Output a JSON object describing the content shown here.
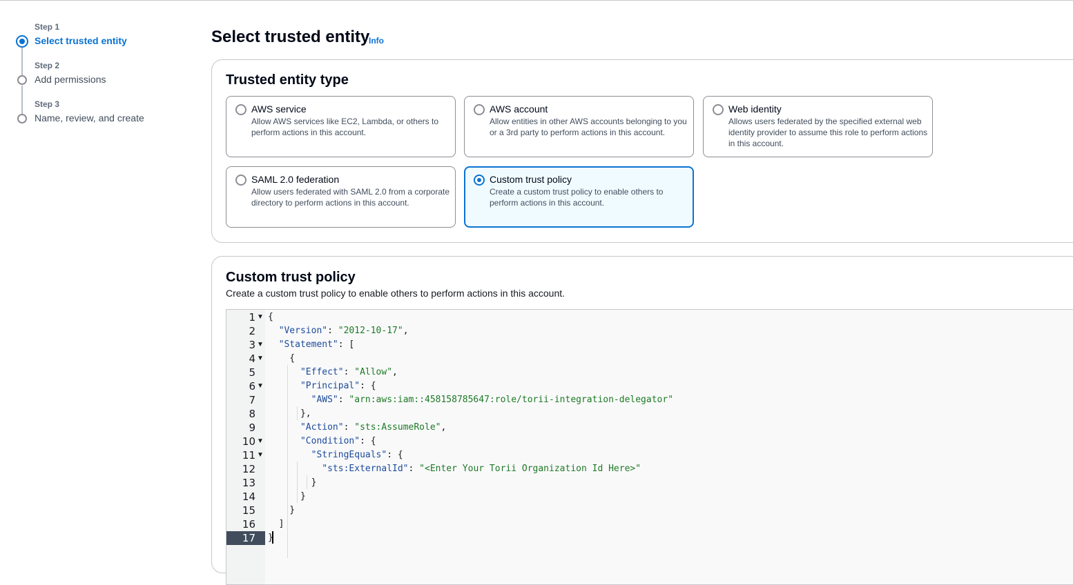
{
  "steps": [
    {
      "number": "Step 1",
      "title": "Select trusted entity",
      "active": true
    },
    {
      "number": "Step 2",
      "title": "Add permissions",
      "active": false
    },
    {
      "number": "Step 3",
      "title": "Name, review, and create",
      "active": false
    }
  ],
  "header": {
    "title": "Select trusted entity",
    "info_label": "Info"
  },
  "entity_type": {
    "title": "Trusted entity type",
    "options": [
      {
        "label": "AWS service",
        "description": "Allow AWS services like EC2, Lambda, or others to perform actions in this account.",
        "selected": false
      },
      {
        "label": "AWS account",
        "description": "Allow entities in other AWS accounts belonging to you or a 3rd party to perform actions in this account.",
        "selected": false
      },
      {
        "label": "Web identity",
        "description": "Allows users federated by the specified external web identity provider to assume this role to perform actions in this account.",
        "selected": false
      },
      {
        "label": "SAML 2.0 federation",
        "description": "Allow users federated with SAML 2.0 from a corporate directory to perform actions in this account.",
        "selected": false
      },
      {
        "label": "Custom trust policy",
        "description": "Create a custom trust policy to enable others to perform actions in this account.",
        "selected": true
      }
    ]
  },
  "policy": {
    "title": "Custom trust policy",
    "description": "Create a custom trust policy to enable others to perform actions in this account.",
    "active_line": 17,
    "lines": [
      {
        "n": "1",
        "fold": true,
        "text": "{"
      },
      {
        "n": "2",
        "fold": false,
        "text": "  \"Version\": \"2012-10-17\","
      },
      {
        "n": "3",
        "fold": true,
        "text": "  \"Statement\": ["
      },
      {
        "n": "4",
        "fold": true,
        "text": "    {"
      },
      {
        "n": "5",
        "fold": false,
        "text": "      \"Effect\": \"Allow\","
      },
      {
        "n": "6",
        "fold": true,
        "text": "      \"Principal\": {"
      },
      {
        "n": "7",
        "fold": false,
        "text": "        \"AWS\": \"arn:aws:iam::458158785647:role/torii-integration-delegator\""
      },
      {
        "n": "8",
        "fold": false,
        "text": "      },"
      },
      {
        "n": "9",
        "fold": false,
        "text": "      \"Action\": \"sts:AssumeRole\","
      },
      {
        "n": "10",
        "fold": true,
        "text": "      \"Condition\": {"
      },
      {
        "n": "11",
        "fold": true,
        "text": "        \"StringEquals\": {"
      },
      {
        "n": "12",
        "fold": false,
        "text": "          \"sts:ExternalId\": \"<Enter Your Torii Organization Id Here>\""
      },
      {
        "n": "13",
        "fold": false,
        "text": "        }"
      },
      {
        "n": "14",
        "fold": false,
        "text": "      }"
      },
      {
        "n": "15",
        "fold": false,
        "text": "    }"
      },
      {
        "n": "16",
        "fold": false,
        "text": "  ]"
      },
      {
        "n": "17",
        "fold": false,
        "text": "}"
      }
    ]
  },
  "colors": {
    "accent": "#0972d3",
    "selected_tile_bg": "#f0fbff",
    "json_key": "#1c4a9a",
    "json_string": "#1d7a24"
  },
  "icons": {
    "fold": "fold-arrow-icon",
    "radio": "radio-button-icon"
  }
}
